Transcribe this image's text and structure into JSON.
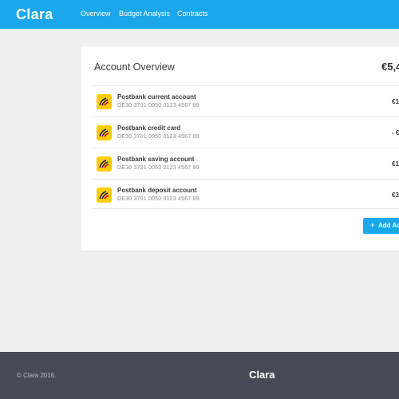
{
  "app": {
    "logo": "Clara"
  },
  "nav": {
    "items": [
      {
        "label": "Overview",
        "active": true
      },
      {
        "label": "Budget Analysis",
        "active": false
      },
      {
        "label": "Contracts",
        "active": false
      }
    ]
  },
  "overview": {
    "title": "Account Overview",
    "total": "€5,4",
    "accounts": [
      {
        "name": "Postbank current account",
        "iban": "DE30 3701 0050 0123 4567 89",
        "amount": "€1",
        "icon": "postbank-icon"
      },
      {
        "name": "Postbank credit card",
        "iban": "DE30 3701 0050 0123 4567 89",
        "amount": "- €",
        "icon": "postbank-icon"
      },
      {
        "name": "Postbank saving account",
        "iban": "DE30 3701 0050 0123 4567 89",
        "amount": "€1",
        "icon": "postbank-icon"
      },
      {
        "name": "Postbank deposit account",
        "iban": "DE30 3701 0050 0123 4567 89",
        "amount": "€3",
        "icon": "postbank-icon"
      }
    ],
    "add_button": {
      "icon": "+",
      "label": "Add Ac"
    }
  },
  "footer": {
    "copyright": "© Clara 2016.",
    "logo": "Clara"
  },
  "colors": {
    "accent": "#1aa7ec",
    "footer_bg": "#474a55",
    "page_bg": "#efefef",
    "bank_icon_bg": "#ffcc00"
  }
}
